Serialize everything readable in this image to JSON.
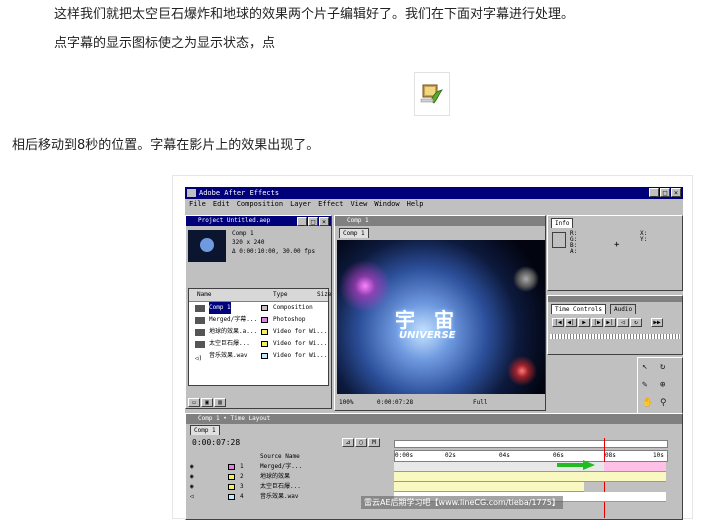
{
  "paragraphs": {
    "p1": "这样我们就把太空巨石爆炸和地球的效果两个片子编辑好了。我们在下面对字幕进行处理。",
    "p2": "点字幕的显示图标使之为显示状态，点",
    "p3": "相后移动到8秒的位置。字幕在影片上的效果出现了。"
  },
  "inline_icon": "layer-visibility-icon",
  "ae_window": {
    "title": "Adobe After Effects",
    "menu": [
      "File",
      "Edit",
      "Composition",
      "Layer",
      "Effect",
      "View",
      "Window",
      "Help"
    ],
    "project": {
      "title": "Project Untitled.aep",
      "comp_name": "Comp 1",
      "comp_size": "320 x 240",
      "comp_duration": "Δ 0:00:10:00, 30.00 fps",
      "headers": [
        "Name",
        "Type",
        "Size"
      ],
      "items": [
        {
          "name": "Comp 1",
          "type": "Composition",
          "color": "#c0c0c0"
        },
        {
          "name": "Merged/字幕...",
          "type": "Photoshop",
          "color": "#e080e0"
        },
        {
          "name": "地球的效果.a...",
          "type": "Video for Wi...",
          "color": "#f0f060"
        },
        {
          "name": "太空巨石爆...",
          "type": "Video for Wi...",
          "color": "#f0f060"
        },
        {
          "name": "音乐效果.wav",
          "type": "Video for Wi...",
          "color": "#c0e8ff"
        }
      ]
    },
    "comp_window": {
      "title": "Comp 1",
      "tab": "Comp 1",
      "title_text_cn": "宇 宙",
      "title_text_en": "UNIVERSE",
      "zoom": "100%",
      "timecode": "0:00:07:28",
      "quality": "Full"
    },
    "info": {
      "tab": "Info",
      "labels": [
        "R:",
        "G:",
        "B:",
        "A:",
        "X:",
        "Y:"
      ]
    },
    "time_controls": {
      "tabs": [
        "Time Controls",
        "Audio"
      ]
    },
    "timeline": {
      "title": "Comp 1 • Time Layout",
      "tab": "Comp 1",
      "timecode": "0:00:07:28",
      "source_name_header": "Source Name",
      "ruler": [
        "0:00s",
        "02s",
        "04s",
        "06s",
        "08s",
        "10s"
      ],
      "layers": [
        {
          "num": "1",
          "name": "Merged/字...",
          "color": "#e080e0"
        },
        {
          "num": "2",
          "name": "地球的效果",
          "color": "#f0f060"
        },
        {
          "num": "3",
          "name": "太空巨石爆...",
          "color": "#f0f060"
        },
        {
          "num": "4",
          "name": "音乐效果.wav",
          "color": "#c0e8ff"
        }
      ]
    }
  },
  "watermark": "雷云AE后期学习吧【www.lineCG.com/tieba/1775】"
}
